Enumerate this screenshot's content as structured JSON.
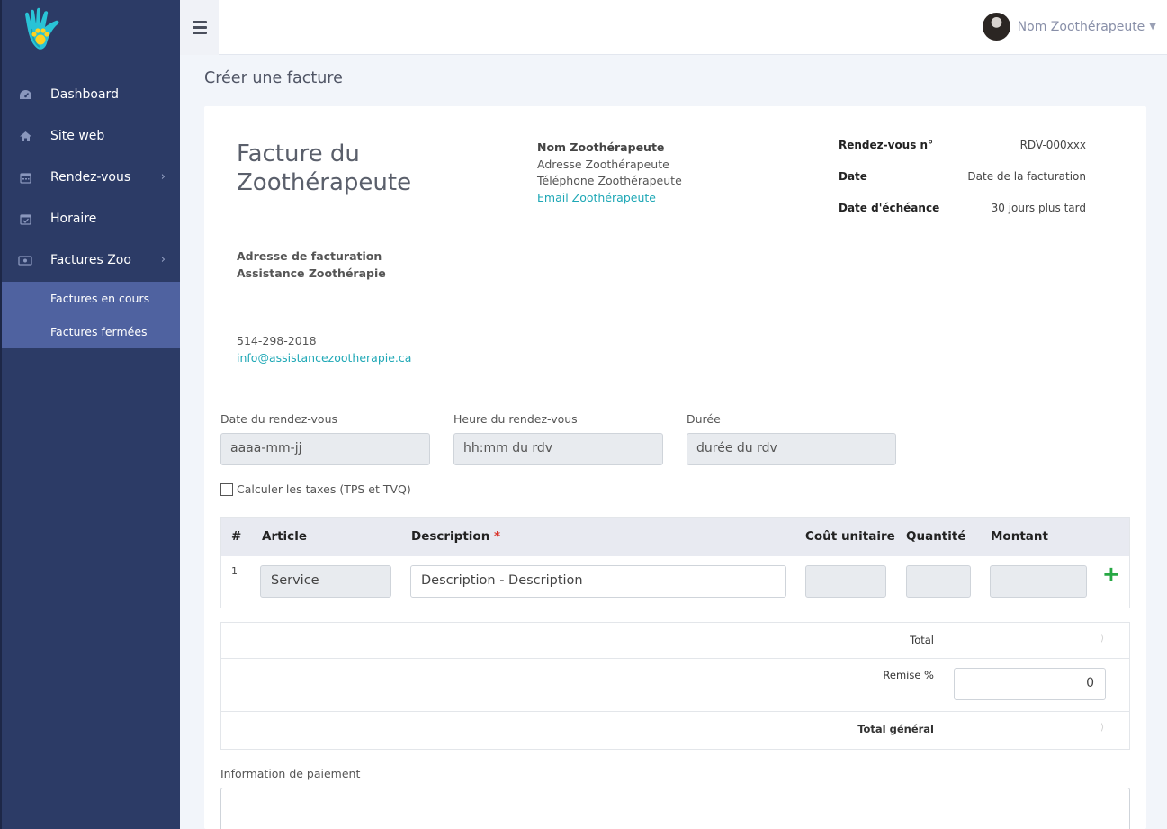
{
  "sidebar": {
    "items": [
      {
        "label": "Dashboard",
        "icon": "dashboard-icon"
      },
      {
        "label": "Site web",
        "icon": "home-icon"
      },
      {
        "label": "Rendez-vous",
        "icon": "calendar-icon"
      },
      {
        "label": "Horaire",
        "icon": "calendar-check-icon"
      },
      {
        "label": "Factures Zoo",
        "icon": "money-icon"
      }
    ],
    "subitems": [
      {
        "label": "Factures en cours"
      },
      {
        "label": "Factures fermées"
      }
    ]
  },
  "topbar": {
    "user_name": "Nom Zoothérapeute"
  },
  "page": {
    "title": "Créer une facture"
  },
  "invoice": {
    "title": "Facture du Zoothérapeute",
    "vet": {
      "name": "Nom Zoothérapeute",
      "address": "Adresse Zoothérapeute",
      "phone": "Téléphone Zoothérapeute",
      "email": "Email Zoothérapeute"
    },
    "meta": [
      {
        "key": "Rendez-vous n°",
        "value": "RDV-000xxx"
      },
      {
        "key": "Date",
        "value": "Date de la facturation"
      },
      {
        "key": "Date d'échéance",
        "value": "30 jours plus tard"
      }
    ],
    "billing": {
      "heading": "Adresse de facturation",
      "name": "Assistance Zoothérapie",
      "phone": "514-298-2018",
      "email": "info@assistancezootherapie.ca"
    }
  },
  "fields": {
    "date_label": "Date du rendez-vous",
    "date_value": "aaaa-mm-jj",
    "time_label": "Heure du rendez-vous",
    "time_value": "hh:mm du rdv",
    "duration_label": "Durée",
    "duration_value": "durée du rdv"
  },
  "tax_label": "Calculer les taxes (TPS et TVQ)",
  "table": {
    "headers": {
      "num": "#",
      "article": "Article",
      "description": "Description",
      "required": "*",
      "unit_cost": "Coût unitaire",
      "quantity": "Quantité",
      "amount": "Montant"
    },
    "rows": [
      {
        "num": "1",
        "article": "Service",
        "description": "Description - Description"
      }
    ],
    "add_symbol": "+"
  },
  "totals": {
    "total_label": "Total",
    "remise_label": "Remise %",
    "remise_value": "0",
    "grand_total_label": "Total général"
  },
  "payment": {
    "label": "Information de paiement"
  },
  "colors": {
    "sidebar": "#2c3b66",
    "submenu": "#4f62a0",
    "accent": "#1fa8b6",
    "add": "#27a844"
  }
}
